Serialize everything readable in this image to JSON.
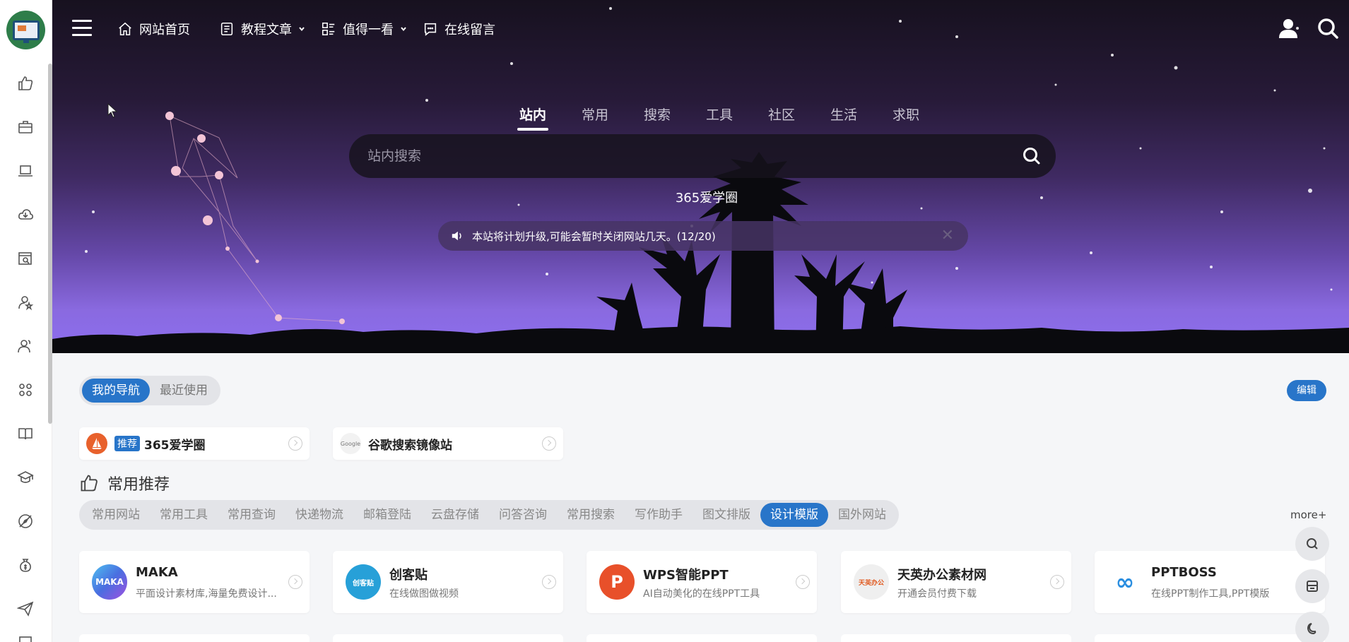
{
  "topnav": {
    "items": [
      {
        "label": "网站首页",
        "icon": "home-icon",
        "dropdown": false
      },
      {
        "label": "教程文章",
        "icon": "document-icon",
        "dropdown": true
      },
      {
        "label": "值得一看",
        "icon": "list-icon",
        "dropdown": true
      },
      {
        "label": "在线留言",
        "icon": "message-icon",
        "dropdown": false
      }
    ]
  },
  "search": {
    "tabs": [
      "站内",
      "常用",
      "搜索",
      "工具",
      "社区",
      "生活",
      "求职"
    ],
    "active_tab": 0,
    "placeholder": "站内搜索"
  },
  "site_name": "365爱学圈",
  "notice": {
    "text": "本站将计划升级,可能会暂时关闭网站几天。(12/20)",
    "close": "✕"
  },
  "my_nav": {
    "tabs": [
      "我的导航",
      "最近使用"
    ],
    "active_tab": 0,
    "edit_label": "编辑",
    "items": [
      {
        "badge": "推荐",
        "title": "365爱学圈"
      },
      {
        "badge": "",
        "title": "谷歌搜索镜像站",
        "logo_text": "Google"
      }
    ]
  },
  "section": {
    "title": "常用推荐",
    "tabs": [
      "常用网站",
      "常用工具",
      "常用查询",
      "快递物流",
      "邮箱登陆",
      "云盘存储",
      "问答咨询",
      "常用搜索",
      "写作助手",
      "图文排版",
      "设计模版",
      "国外网站"
    ],
    "active_tab": 10,
    "more_label": "more+",
    "sites": [
      {
        "name": "MAKA",
        "desc": "平面设计素材库,海量免费设计...",
        "logo_text": "MAKA",
        "color": "#3b8fe0"
      },
      {
        "name": "创客贴",
        "desc": "在线做图做视频",
        "logo_text": "创客贴",
        "color": "#27a0d8"
      },
      {
        "name": "WPS智能PPT",
        "desc": "AI自动美化的在线PPT工具",
        "logo_text": "P",
        "color": "#e8502a"
      },
      {
        "name": "天英办公素材网",
        "desc": "开通会员付费下载",
        "logo_text": "天英办公",
        "color": "#efefef"
      },
      {
        "name": "PPTBOSS",
        "desc": "在线PPT制作工具,PPT模版",
        "logo_text": "∞",
        "color": "#ffffff"
      }
    ]
  },
  "colors": {
    "accent": "#2875c9"
  }
}
